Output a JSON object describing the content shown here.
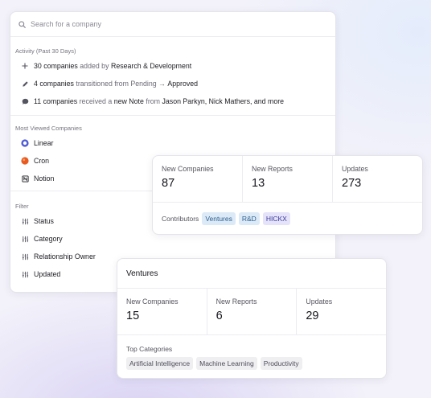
{
  "search": {
    "placeholder": "Search for a company"
  },
  "activity": {
    "title": "Activity (Past 30 Days)",
    "items": [
      {
        "icon": "plus-icon",
        "count": "30 companies",
        "verb": "added by",
        "target": "Research & Development",
        "extra": ""
      },
      {
        "icon": "pencil-icon",
        "count": "4 companies",
        "verb": "transitioned from Pending →",
        "target": "Approved",
        "extra": ""
      },
      {
        "icon": "comment-icon",
        "count": "11 companies",
        "verb": "received a",
        "target": "new Note",
        "from": "from",
        "people": "Jason Parkyn, Nick Mathers, and more"
      }
    ]
  },
  "most_viewed": {
    "title": "Most Viewed Companies",
    "items": [
      {
        "label": "Linear",
        "icon": "linear-logo-icon",
        "color": "#4f5bd5"
      },
      {
        "label": "Cron",
        "icon": "cron-logo-icon",
        "color": "#e85a1f"
      },
      {
        "label": "Notion",
        "icon": "notion-logo-icon",
        "color": "#1d1d24"
      }
    ]
  },
  "filter": {
    "title": "Filter",
    "items": [
      {
        "label": "Status"
      },
      {
        "label": "Category"
      },
      {
        "label": "Relationship Owner"
      },
      {
        "label": "Updated"
      }
    ]
  },
  "stats_overall": {
    "metrics": [
      {
        "label": "New Companies",
        "value": "87"
      },
      {
        "label": "New Reports",
        "value": "13"
      },
      {
        "label": "Updates",
        "value": "273"
      }
    ],
    "contributors_label": "Contributors",
    "contributors": [
      {
        "label": "Ventures",
        "style": "blue"
      },
      {
        "label": "R&D",
        "style": "blue"
      },
      {
        "label": "HICKX",
        "style": "indigo"
      }
    ]
  },
  "stats_ventures": {
    "title": "Ventures",
    "metrics": [
      {
        "label": "New Companies",
        "value": "15"
      },
      {
        "label": "New Reports",
        "value": "6"
      },
      {
        "label": "Updates",
        "value": "29"
      }
    ],
    "top_categories_label": "Top Categories",
    "top_categories": [
      {
        "label": "Artificial Intelligence"
      },
      {
        "label": "Machine Learning"
      },
      {
        "label": "Productivity"
      }
    ]
  },
  "colors": {
    "chip_blue_bg": "#dceaf7",
    "chip_indigo_bg": "#e4e3fa",
    "linear": "#4f5bd5",
    "cron": "#e85a1f"
  }
}
